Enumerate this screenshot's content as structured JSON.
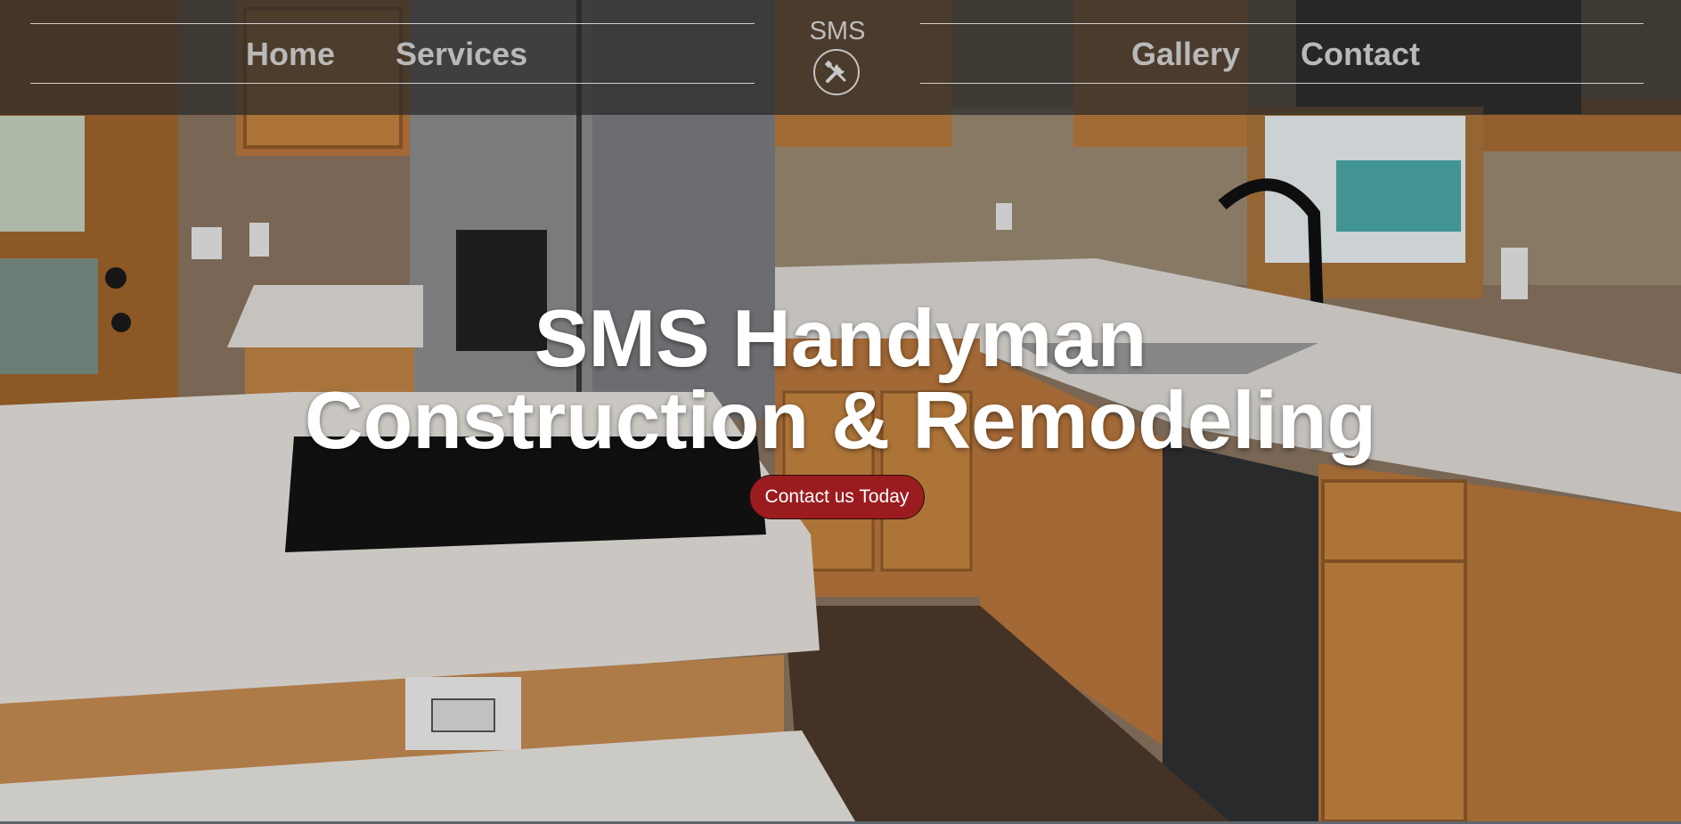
{
  "nav": {
    "links_left": [
      {
        "label": "Home"
      },
      {
        "label": "Services"
      }
    ],
    "links_right": [
      {
        "label": "Gallery"
      },
      {
        "label": "Contact"
      }
    ],
    "logo": {
      "text": "SMS",
      "icon": "tools-icon"
    }
  },
  "hero": {
    "title_line1": "SMS Handyman",
    "title_line2": "Construction & Remodeling",
    "cta_label": "Contact us Today",
    "background": "kitchen-photo"
  },
  "colors": {
    "cta_background": "#9b1c1f",
    "nav_overlay": "#282828",
    "title_text": "#ffffff",
    "nav_text": "#b9b9b9"
  }
}
